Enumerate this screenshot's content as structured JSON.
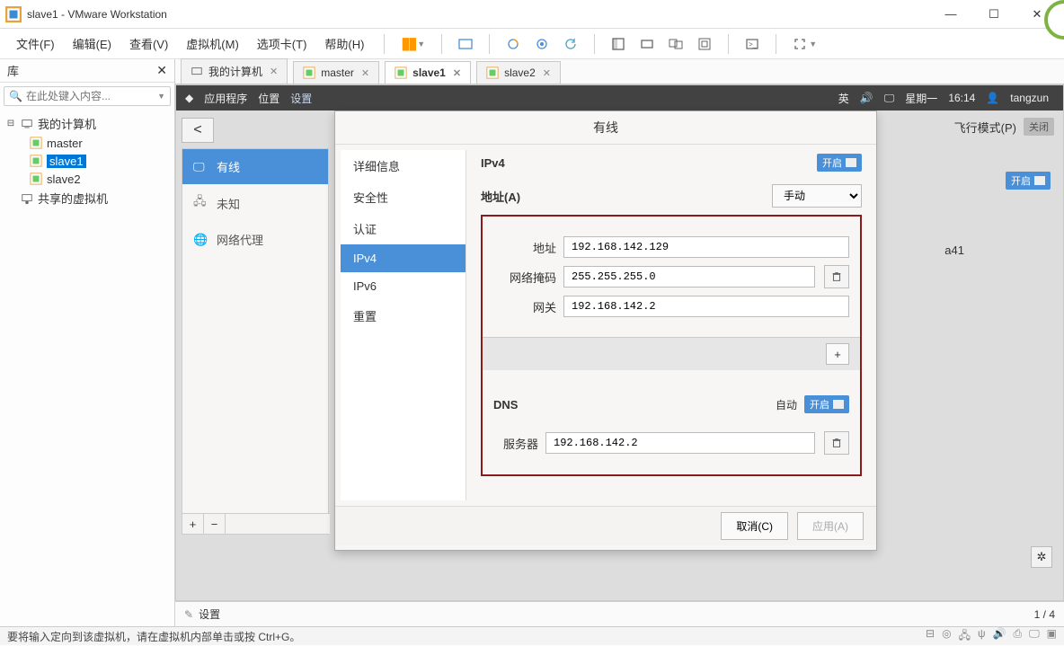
{
  "titlebar": {
    "text": "slave1 - VMware Workstation"
  },
  "menubar": {
    "file": "文件(F)",
    "edit": "编辑(E)",
    "view": "查看(V)",
    "vm": "虚拟机(M)",
    "tabs": "选项卡(T)",
    "help": "帮助(H)"
  },
  "library": {
    "title": "库",
    "search_placeholder": "在此处键入内容...",
    "root": "我的计算机",
    "vms": [
      "master",
      "slave1",
      "slave2"
    ],
    "shared": "共享的虚拟机"
  },
  "vm_tabs": {
    "home": "我的计算机",
    "items": [
      "master",
      "slave1",
      "slave2"
    ],
    "active": "slave1"
  },
  "gnome_top": {
    "apps": "应用程序",
    "places": "位置",
    "settings": "设置",
    "ime": "英",
    "day": "星期一",
    "time": "16:14",
    "user": "tangzun"
  },
  "net_panel": {
    "wired": "有线",
    "unknown": "未知",
    "proxy": "网络代理"
  },
  "right_bits": {
    "airplane": "飞行模式(P)",
    "airplane_state": "关闭",
    "open": "开启",
    "peek": "a41"
  },
  "dialog": {
    "title": "有线",
    "side": {
      "details": "详细信息",
      "security": "安全性",
      "auth": "认证",
      "ipv4": "IPv4",
      "ipv6": "IPv6",
      "reset": "重置"
    },
    "ipv4": {
      "heading": "IPv4",
      "on": "开启",
      "addresses_label": "地址(A)",
      "method": "手动",
      "addr_label": "地址",
      "addr": "192.168.142.129",
      "mask_label": "网络掩码",
      "mask": "255.255.255.0",
      "gw_label": "网关",
      "gw": "192.168.142.2",
      "dns": "DNS",
      "auto": "自动",
      "server_label": "服务器",
      "server": "192.168.142.2"
    },
    "cancel": "取消(C)",
    "apply": "应用(A)"
  },
  "settings_row": {
    "label": "设置",
    "counter": "1 / 4"
  },
  "statusbar": {
    "hint": "要将输入定向到该虚拟机，请在虚拟机内部单击或按 Ctrl+G。"
  }
}
